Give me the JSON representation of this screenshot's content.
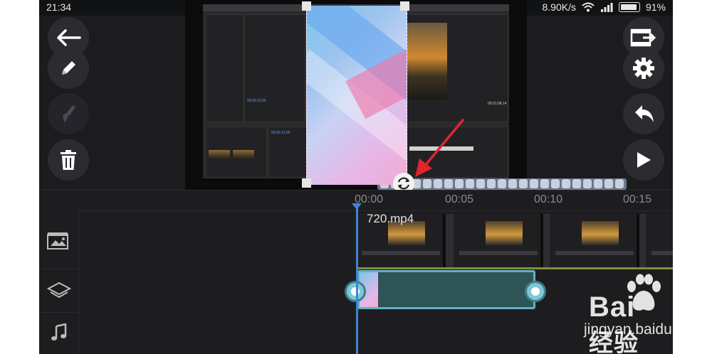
{
  "status_bar": {
    "time": "21:34",
    "network_speed": "8.90K/s",
    "battery_percent": "91%",
    "battery_level": 0.91
  },
  "left_toolbar": {
    "items": [
      {
        "icon": "back-arrow-icon"
      },
      {
        "icon": "pencil-icon"
      },
      {
        "icon": "brush-icon",
        "disabled": true
      },
      {
        "icon": "trash-icon"
      }
    ]
  },
  "right_toolbar": {
    "items": [
      {
        "icon": "export-film-icon"
      },
      {
        "icon": "gear-icon"
      },
      {
        "icon": "undo-icon"
      },
      {
        "icon": "play-icon"
      }
    ]
  },
  "preview": {
    "inner_timecodes": [
      "00:00:12:03",
      "00:01:08:14",
      "00:00:12:03"
    ]
  },
  "timeline": {
    "ruler_ticks": [
      "00:00",
      "00:05",
      "00:10",
      "00:15"
    ],
    "clip_name": "720.mp4",
    "tracks": [
      {
        "icon": "video-track-icon"
      },
      {
        "icon": "layers-icon"
      },
      {
        "icon": "music-note-icon"
      }
    ]
  },
  "watermark": {
    "line1_left": "Bai",
    "line1_right": "经验",
    "line2": "jingyan.baidu.com"
  },
  "colors": {
    "accent": "#3d84d6",
    "overlay_clip": "#2f5458",
    "overlay_border": "#5fb2c2",
    "annotation_arrow": "#e0252b"
  }
}
